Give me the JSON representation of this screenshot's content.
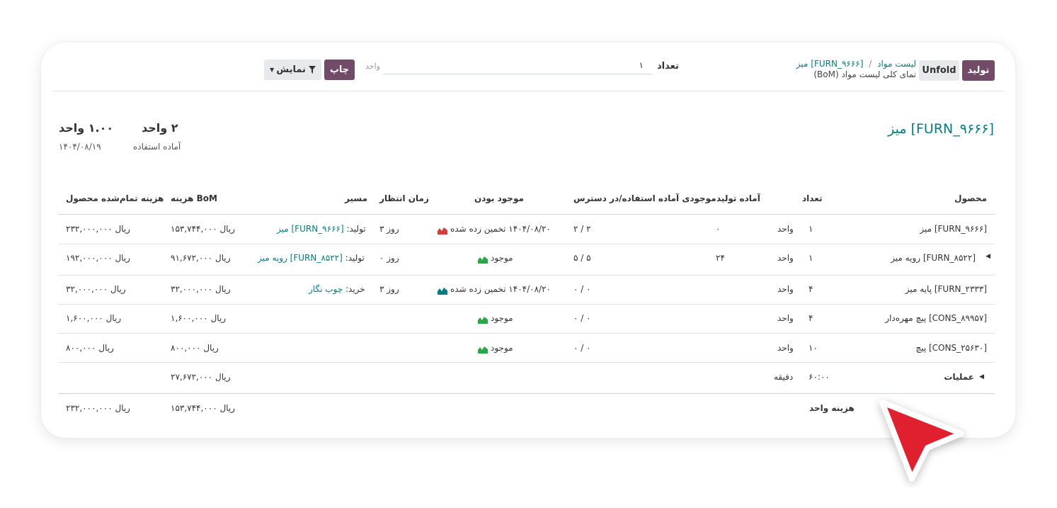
{
  "control_panel": {
    "produce_button": "تولید",
    "unfold_button": "Unfold",
    "breadcrumb_parent": "لیست مواد",
    "breadcrumb_separator": "/",
    "breadcrumb_current": "[FURN_۹۶۶۶] میز",
    "page_subtitle": "نمای کلی لیست مواد (BoM)",
    "quantity_label": "تعداد",
    "quantity_value": "۱",
    "unit_placeholder": "واحد",
    "print_button": "چاپ",
    "display_button": "نمایش"
  },
  "summary": {
    "product_title": "[FURN_۹۶۶۶] میز",
    "ready_qty": "۲ واحد",
    "ready_label": "آماده استفاده",
    "total_qty": "۱.۰۰ واحد",
    "date": "۱۴۰۴/۰۸/۱۹"
  },
  "table": {
    "headers": {
      "product": "محصول",
      "quantity": "تعداد",
      "ready_to_produce": "آماده تولید",
      "free_available": "موجودی آماده استفاده/در دسترس",
      "availability": "موجود بودن",
      "lead_time": "زمان انتظار",
      "route": "مسیر",
      "bom_cost": "هزینه BoM",
      "product_cost": "هزینه تمام‌شده محصول"
    },
    "rows": [
      {
        "product": "[FURN_۹۶۶۶] میز",
        "qty": "۱",
        "uom": "واحد",
        "ready": "۰",
        "free": "۲ / ۲",
        "availability": "۱۴۰۴/۰۸/۲۰ تخمین زده شده",
        "lead": "۳ روز",
        "route_prefix": "تولید:",
        "route_link": "[FURN_۹۶۶۶] میز",
        "bom_cost": "۱۵۳,۷۴۴,۰۰۰ ریال",
        "prod_cost": "۲۳۲,۰۰۰,۰۰۰ ریال"
      },
      {
        "product": "[FURN_۸۵۲۲] رویه میز",
        "qty": "۱",
        "uom": "واحد",
        "ready": "۲۴",
        "free": "۵ / ۵",
        "availability": "موجود",
        "lead": "۰ روز",
        "route_prefix": "تولید:",
        "route_link": "[FURN_۸۵۲۲] رویه میز",
        "bom_cost": "۹۱,۶۷۲,۰۰۰ ریال",
        "prod_cost": "۱۹۲,۰۰۰,۰۰۰ ریال"
      },
      {
        "product": "[FURN_۲۳۳۳] پایه میز",
        "qty": "۴",
        "uom": "واحد",
        "ready": "",
        "free": "۰ / ۰",
        "availability": "۱۴۰۴/۰۸/۲۰ تخمین زده شده",
        "lead": "۳ روز",
        "route_prefix": "خرید:",
        "route_link": "چوب نگار",
        "bom_cost": "۳۲,۰۰۰,۰۰۰ ریال",
        "prod_cost": "۳۲,۰۰۰,۰۰۰ ریال"
      },
      {
        "product": "[CONS_۸۹۹۵۷] پیچ مهره‌دار",
        "qty": "۴",
        "uom": "واحد",
        "ready": "",
        "free": "۰ / ۰",
        "availability": "موجود",
        "lead": "",
        "route_prefix": "",
        "route_link": "",
        "bom_cost": "۱,۶۰۰,۰۰۰ ریال",
        "prod_cost": "۱,۶۰۰,۰۰۰ ریال"
      },
      {
        "product": "[CONS_۲۵۶۳۰] پیچ",
        "qty": "۱۰",
        "uom": "واحد",
        "ready": "",
        "free": "۰ / ۰",
        "availability": "موجود",
        "lead": "",
        "route_prefix": "",
        "route_link": "",
        "bom_cost": "۸۰۰,۰۰۰ ریال",
        "prod_cost": "۸۰۰,۰۰۰ ریال"
      }
    ],
    "operations": {
      "label": "عملیات",
      "qty": "۶۰:۰۰",
      "uom": "دقیقه",
      "bom_cost": "۲۷,۶۷۲,۰۰۰ ریال"
    },
    "unit_cost": {
      "label": "هزینه واحد",
      "bom_cost": "۱۵۳,۷۴۴,۰۰۰ ریال",
      "prod_cost": "۲۳۲,۰۰۰,۰۰۰ ریال"
    }
  },
  "colors": {
    "primary": "#714b67",
    "link": "#017e84",
    "warning": "#d23f3a",
    "success": "#28a745",
    "cursor": "#e0202e"
  }
}
